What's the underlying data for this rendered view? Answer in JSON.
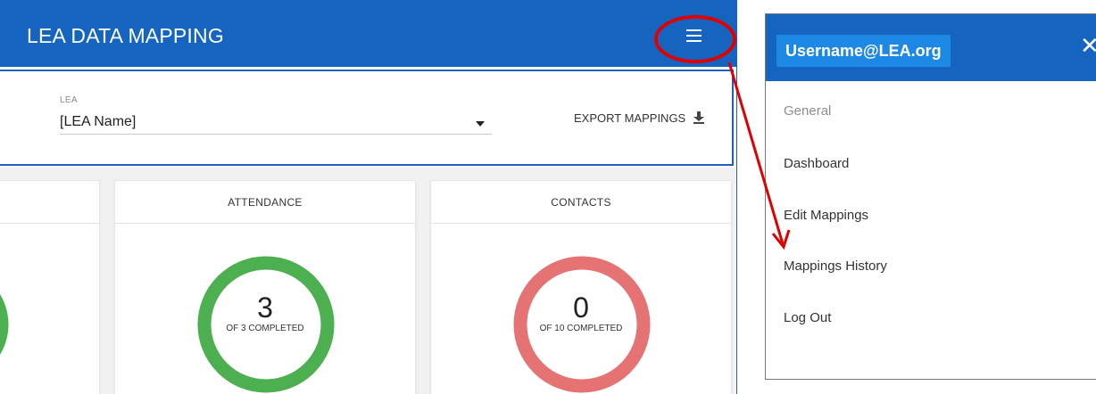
{
  "app": {
    "title": "LEA DATA MAPPING",
    "menu_icon": "hamburger-menu-icon"
  },
  "filter": {
    "lea_label": "LEA",
    "lea_value": "[LEA Name]",
    "export_label": "EXPORT MAPPINGS",
    "export_icon": "download-icon"
  },
  "cards": [
    {
      "title": "",
      "count": "",
      "subtitle": "",
      "progress": 1.0,
      "color": "#4caf50"
    },
    {
      "title": "ATTENDANCE",
      "count": "3",
      "subtitle": "OF 3 COMPLETED",
      "progress": 1.0,
      "color": "#4caf50"
    },
    {
      "title": "CONTACTS",
      "count": "0",
      "subtitle": "OF 10 COMPLETED",
      "progress": 0.0,
      "color": "#e57373"
    }
  ],
  "drawer": {
    "username": "Username@LEA.org",
    "close_icon": "close-icon",
    "items": [
      {
        "label": "General"
      },
      {
        "label": "Dashboard"
      },
      {
        "label": "Edit Mappings"
      },
      {
        "label": "Mappings History"
      },
      {
        "label": "Log Out"
      }
    ]
  },
  "colors": {
    "primary": "#1565c0",
    "chip": "#1e88e5",
    "complete": "#4caf50",
    "incomplete": "#e57373",
    "annotation": "#e00000"
  }
}
